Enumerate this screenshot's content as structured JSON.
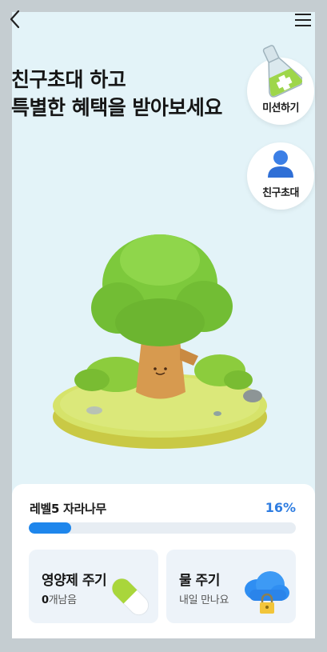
{
  "header": {
    "back_icon": "chevron-left-icon",
    "menu_icon": "hamburger-menu-icon"
  },
  "headline": {
    "line1": "친구초대 하고",
    "line2": "특별한 혜택을 받아보세요"
  },
  "side_buttons": {
    "mission_label": "미션하기",
    "mission_icon": "flask-icon",
    "invite_label": "친구초대",
    "invite_icon": "person-icon"
  },
  "level": {
    "title": "레벨5 자라나무",
    "percent_text": "16%",
    "progress": 0.16
  },
  "cards": {
    "nutrient": {
      "title": "영양제 주기",
      "count": "0",
      "count_suffix": "개남음",
      "icon": "capsule-icon"
    },
    "water": {
      "title": "물 주기",
      "subtitle": "내일 만나요",
      "icon": "locked-cloud-icon"
    }
  },
  "colors": {
    "background": "#e3f3f8",
    "accent": "#1e86ec",
    "percent_text": "#2f7de1"
  }
}
